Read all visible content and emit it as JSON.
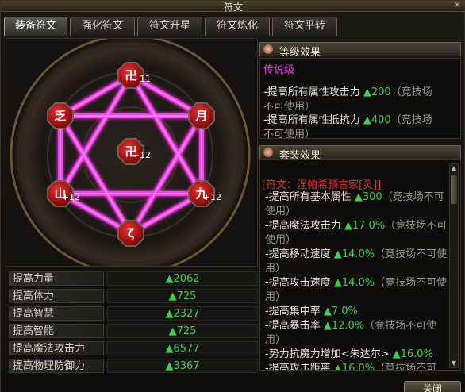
{
  "window": {
    "title": "符文",
    "close_glyph": "×"
  },
  "tabs": [
    {
      "label": "装备符文",
      "active": true
    },
    {
      "label": "强化符文",
      "active": false
    },
    {
      "label": "符文升星",
      "active": false
    },
    {
      "label": "符文炼化",
      "active": false
    },
    {
      "label": "符文平转",
      "active": false
    }
  ],
  "runes": [
    {
      "glyph": "卍",
      "level": "+11",
      "icon": "rune-top-icon"
    },
    {
      "glyph": "月",
      "level": "",
      "icon": "rune-upper-right-icon"
    },
    {
      "glyph": "九",
      "level": "+12",
      "icon": "rune-lower-right-icon"
    },
    {
      "glyph": "ζ",
      "level": "",
      "icon": "rune-bottom-icon"
    },
    {
      "glyph": "山",
      "level": "+12",
      "icon": "rune-lower-left-icon"
    },
    {
      "glyph": "乏",
      "level": "",
      "icon": "rune-upper-left-icon"
    },
    {
      "glyph": "卍",
      "level": "+12",
      "icon": "rune-center-icon"
    }
  ],
  "stats": [
    {
      "label": "提高力量",
      "value": "▲2062"
    },
    {
      "label": "提高体力",
      "value": "▲725"
    },
    {
      "label": "提高智慧",
      "value": "▲2327"
    },
    {
      "label": "提高智能",
      "value": "▲725"
    },
    {
      "label": "提高魔法攻击力",
      "value": "▲6577"
    },
    {
      "label": "提高物理防御力",
      "value": "▲3367"
    }
  ],
  "grade": {
    "header": "等级效果",
    "name": "传说级",
    "lines": [
      {
        "text": "-提高所有属性攻击力 ",
        "value": "▲200",
        "note": "（竞技场",
        "note2": "不可使用）"
      },
      {
        "text": "-提高所有属性抵抗力 ",
        "value": "▲400",
        "note": "（竞技场",
        "note2": "不可使用）"
      }
    ]
  },
  "set": {
    "header": "套装效果",
    "name": "[符文：涅帕希预言家[灵]]",
    "items": [
      {
        "text": "-提高所有基本属性 ",
        "value": "▲300",
        "note": "（竞技场不可使用）"
      },
      {
        "text": "-提高魔法攻击力 ",
        "value": "▲17.0%",
        "note": "（竞技场不可使用）"
      },
      {
        "text": "-提高移动速度 ",
        "value": "▲14.0%",
        "note": "（竞技场不可使用）"
      },
      {
        "text": "-提高攻击速度 ",
        "value": "▲14.0%",
        "note": "（竞技场不可使用）"
      },
      {
        "text": "-提高集中率 ",
        "value": "▲7.0%",
        "note": ""
      },
      {
        "text": "-提高暴击率 ",
        "value": "▲12.0%",
        "note": "（竞技场不可使用）"
      },
      {
        "text": "-势力抗魔力增加<朱达尔> ",
        "value": "▲16.0%",
        "note": ""
      },
      {
        "text": "-提高攻击距离 ",
        "value": "▲16.0%",
        "note": "（竞技场不可"
      }
    ]
  },
  "buttons": {
    "close": "关闭"
  },
  "colors": {
    "accent_pink": "#ff40ff",
    "stat_green": "#3fd04a",
    "rune_red": "#d01818"
  }
}
